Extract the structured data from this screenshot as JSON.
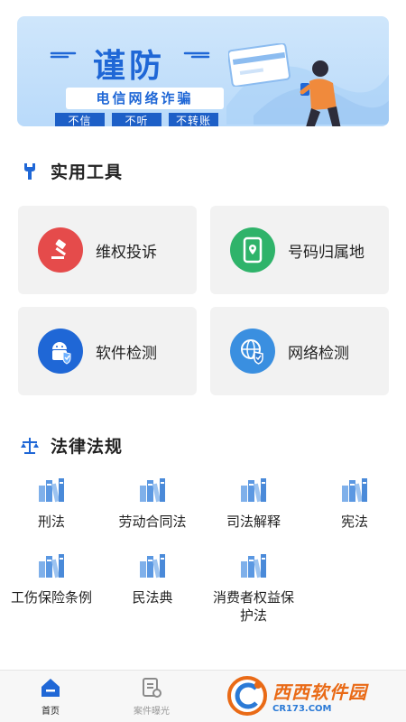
{
  "banner": {
    "title": "谨防",
    "subtitle": "电信网络诈骗",
    "tags": [
      "不信",
      "不听",
      "不转账"
    ],
    "page_count": 3,
    "active_page": 1,
    "colors": {
      "primary": "#1f67d6",
      "background": "#c4e0fb",
      "accent": "#f08a3c"
    }
  },
  "tools_section": {
    "title": "实用工具",
    "icon": "wrench-icon",
    "items": [
      {
        "label": "维权投诉",
        "icon": "gavel-icon",
        "color": "#e54b4b"
      },
      {
        "label": "号码归属地",
        "icon": "phone-location-icon",
        "color": "#2fb36a"
      },
      {
        "label": "软件检测",
        "icon": "android-shield-icon",
        "color": "#1f67d6"
      },
      {
        "label": "网络检测",
        "icon": "globe-shield-icon",
        "color": "#3a8fe0"
      }
    ]
  },
  "laws_section": {
    "title": "法律法规",
    "icon": "scales-icon",
    "items": [
      {
        "label": "刑法"
      },
      {
        "label": "劳动合同法"
      },
      {
        "label": "司法解释"
      },
      {
        "label": "宪法"
      },
      {
        "label": "工伤保险条例"
      },
      {
        "label": "民法典"
      },
      {
        "label": "消费者权益保护法"
      }
    ]
  },
  "bottom_nav": {
    "items": [
      {
        "label": "首页",
        "icon": "home-icon",
        "active": true
      },
      {
        "label": "案件曝光",
        "icon": "case-document-icon",
        "active": false
      },
      {
        "label": "",
        "icon": "",
        "active": false
      },
      {
        "label": "",
        "icon": "",
        "active": false
      }
    ]
  },
  "watermark": {
    "main": "西西软件园",
    "sub": "CR173.COM"
  }
}
